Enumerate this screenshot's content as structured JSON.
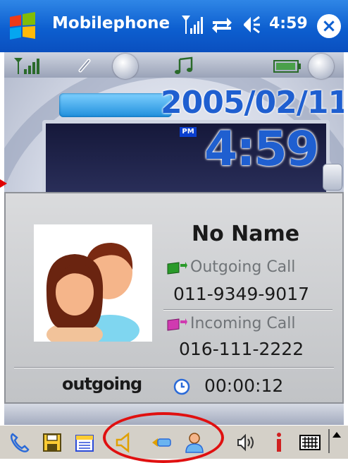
{
  "titlebar": {
    "app_title": "Mobilephone",
    "clock": "4:59",
    "close_label": "×",
    "start_icon": "windows-flag-icon",
    "signal_icon": "signal-icon",
    "sync_icon": "sync-icon",
    "volume_icon": "speaker-icon"
  },
  "skin": {
    "date": "2005/02/11",
    "ampm": "PM",
    "time": "4:59",
    "icons": [
      "signal-strength-icon",
      "link-icon",
      "music-icon",
      "battery-icon"
    ]
  },
  "call": {
    "contact_name": "No Name",
    "outgoing_label": "Outgoing Call",
    "outgoing_number": "011-9349-9017",
    "incoming_label": "Incoming Call",
    "incoming_number": "016-111-2222",
    "state": "outgoing",
    "duration": "00:00:12"
  },
  "toolbar": {
    "items": [
      "phone-icon",
      "save-icon",
      "calendar-icon",
      "speaker-left-icon",
      "key-icon",
      "contact-icon",
      "volume-icon",
      "info-icon",
      "keyboard-icon"
    ]
  },
  "colors": {
    "titlebar": "#0d5fd0",
    "digital_blue": "#1f5fd0",
    "annotation_red": "#e01010"
  }
}
